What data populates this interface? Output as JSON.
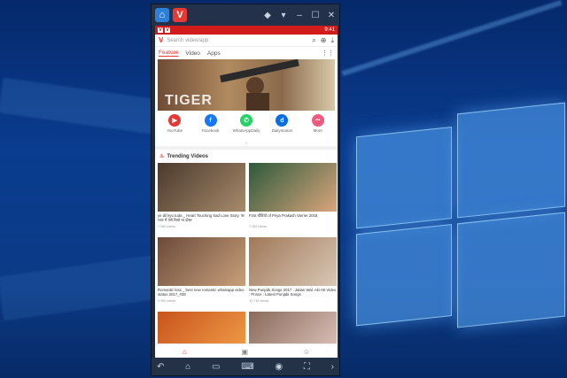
{
  "emulator": {
    "tab_app_icons": [
      "home-icon",
      "v-app-icon"
    ],
    "window_controls": [
      "pin-icon",
      "wifi-icon",
      "minimize-icon",
      "maximize-icon",
      "close-icon"
    ]
  },
  "status_bar": {
    "time": "9:41"
  },
  "app_bar": {
    "logo": "V",
    "search_placeholder": "Search video/app"
  },
  "tabs": [
    {
      "label": "Feature",
      "active": true
    },
    {
      "label": "Video",
      "active": false
    },
    {
      "label": "Apps",
      "active": false
    }
  ],
  "banner": {
    "text": "TIGER"
  },
  "shortcuts": [
    {
      "label": "YouTube",
      "icon": "youtube-icon",
      "color": "#e53935",
      "glyph": "▶"
    },
    {
      "label": "Facebook",
      "icon": "facebook-icon",
      "color": "#1877f2",
      "glyph": "f"
    },
    {
      "label": "WhatsAppDaily",
      "icon": "whatsapp-icon",
      "color": "#25d366",
      "glyph": "✆"
    },
    {
      "label": "Dailymotion",
      "icon": "dailymotion-icon",
      "color": "#0a6ee0",
      "glyph": "d"
    },
    {
      "label": "More",
      "icon": "more-icon",
      "color": "#f05a7e",
      "glyph": "•••"
    }
  ],
  "trending": {
    "title": "Trending Videos",
    "videos": [
      {
        "title": "ye dil kyu tuda _ Heart Touching Sad Love Story. पर प्यार में ऐसे रिश्ते ना दोस्त",
        "views": "7.5M views",
        "colors": [
          "#4a3a2c",
          "#a78a6c"
        ]
      },
      {
        "title": "First वीडियो of Priya Prakash Varrier 2018",
        "views": "7.8M views",
        "colors": [
          "#2d5a3b",
          "#d9a57c"
        ]
      },
      {
        "title": "Romantic kiss _ best new romantic whatsapp video status 2017_#38",
        "views": "2.9M views",
        "colors": [
          "#6b4a3a",
          "#c8a07a"
        ]
      },
      {
        "title": "New Punjabi Songs 2017 : Jatian Wal. Aki Hit Video : Prince : Latest Punjabi Songs",
        "views": "10.7M views",
        "colors": [
          "#a07858",
          "#d8c7b5"
        ]
      },
      {
        "title": "",
        "views": "",
        "colors": [
          "#c8541c",
          "#f2a14a"
        ]
      },
      {
        "title": "",
        "views": "",
        "colors": [
          "#8a6a5a",
          "#e0c8c0"
        ]
      }
    ]
  },
  "bottom_nav": [
    {
      "label": "Home",
      "icon": "home-icon"
    },
    {
      "label": "Trending",
      "icon": "trending-icon"
    },
    {
      "label": "Me",
      "icon": "profile-icon"
    }
  ],
  "emulator_bottom": [
    "back-icon",
    "home-icon",
    "recents-icon",
    "keyboard-icon",
    "eye-icon",
    "fullscreen-icon",
    "expand-icon"
  ]
}
